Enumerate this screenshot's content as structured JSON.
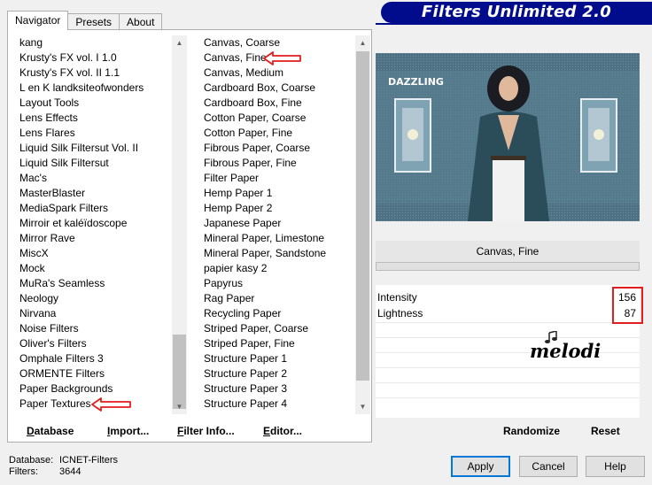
{
  "header": {
    "title": "Filters Unlimited 2.0"
  },
  "tabs": [
    {
      "label": "Navigator",
      "active": true
    },
    {
      "label": "Presets",
      "active": false
    },
    {
      "label": "About",
      "active": false
    }
  ],
  "categories": [
    "kang",
    "Krusty's FX vol. I 1.0",
    "Krusty's FX vol. II 1.1",
    "L en K landksiteofwonders",
    "Layout Tools",
    "Lens Effects",
    "Lens Flares",
    "Liquid Silk Filtersut Vol. II",
    "Liquid Silk Filtersut",
    "Mac's",
    "MasterBlaster",
    "MediaSpark Filters",
    "Mirroir et kaléïdoscope",
    "Mirror Rave",
    "MiscX",
    "Mock",
    "MuRa's Seamless",
    "Neology",
    "Nirvana",
    "Noise Filters",
    "Oliver's Filters",
    "Omphale Filters 3",
    "ORMENTE Filters",
    "Paper Backgrounds",
    "Paper Textures"
  ],
  "filters": [
    "Canvas, Coarse",
    "Canvas, Fine",
    "Canvas, Medium",
    "Cardboard Box, Coarse",
    "Cardboard Box, Fine",
    "Cotton Paper, Coarse",
    "Cotton Paper, Fine",
    "Fibrous Paper, Coarse",
    "Fibrous Paper, Fine",
    "Filter Paper",
    "Hemp Paper 1",
    "Hemp Paper 2",
    "Japanese Paper",
    "Mineral Paper, Limestone",
    "Mineral Paper, Sandstone",
    "papier kasy 2",
    "Papyrus",
    "Rag Paper",
    "Recycling Paper",
    "Striped Paper, Coarse",
    "Striped Paper, Fine",
    "Structure Paper 1",
    "Structure Paper 2",
    "Structure Paper 3",
    "Structure Paper 4"
  ],
  "nav_buttons": {
    "database": "Database",
    "import": "Import...",
    "filter_info": "Filter Info...",
    "editor": "Editor..."
  },
  "preview": {
    "label": "DAZZLING",
    "signature": "melodi"
  },
  "selected_filter": "Canvas, Fine",
  "params": [
    {
      "label": "Intensity",
      "value": "156"
    },
    {
      "label": "Lightness",
      "value": "87"
    }
  ],
  "right_buttons": {
    "randomize": "Randomize",
    "reset": "Reset"
  },
  "status": {
    "database_label": "Database:",
    "database_value": "ICNET-Filters",
    "filters_label": "Filters:",
    "filters_value": "3644"
  },
  "window_buttons": {
    "apply": "Apply",
    "cancel": "Cancel",
    "help": "Help"
  },
  "colors": {
    "banner": "#000c8c",
    "highlight": "#e21d1d",
    "scroll_thumb": "#c1c1c1"
  }
}
